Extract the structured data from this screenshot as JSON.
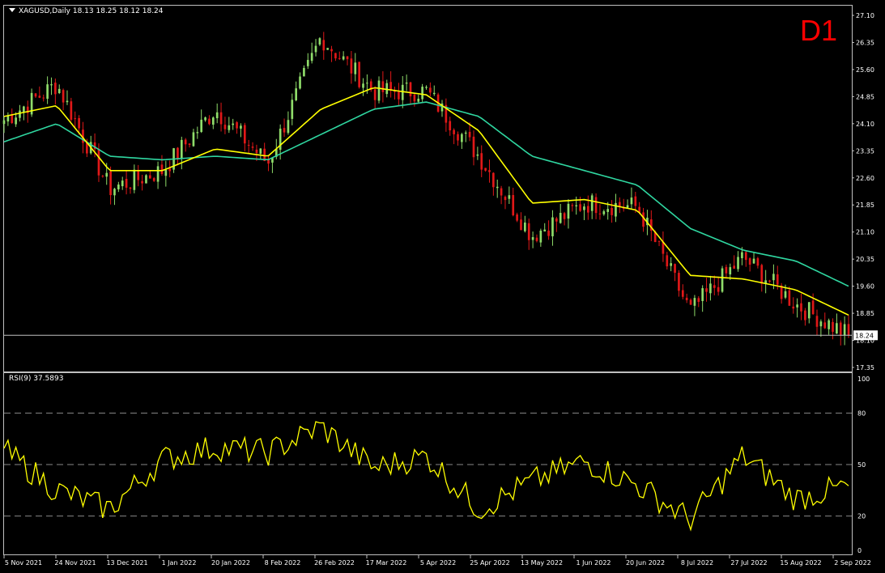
{
  "header": {
    "symbol_line": "XAGUSD,Daily  18.13 18.25 18.12 18.24",
    "timeframe_label": "D1",
    "rsi_label": "RSI(9) 37.5893"
  },
  "price_axis": [
    "27.10",
    "26.35",
    "25.60",
    "24.85",
    "24.10",
    "23.35",
    "22.60",
    "21.85",
    "21.10",
    "20.35",
    "19.60",
    "18.85",
    "18.10",
    "17.35"
  ],
  "current_price": "18.24",
  "rsi_axis": [
    "100",
    "80",
    "50",
    "20",
    "0"
  ],
  "date_axis": [
    "5 Nov 2021",
    "24 Nov 2021",
    "13 Dec 2021",
    "1 Jan 2022",
    "20 Jan 2022",
    "8 Feb 2022",
    "26 Feb 2022",
    "17 Mar 2022",
    "5 Apr 2022",
    "25 Apr 2022",
    "13 May 2022",
    "1 Jun 2022",
    "20 Jun 2022",
    "8 Jul 2022",
    "27 Jul 2022",
    "15 Aug 2022",
    "2 Sep 2022"
  ],
  "colors": {
    "bull": "#8fdc6a",
    "bear": "#e01818",
    "ma_fast": "#ffff00",
    "ma_slow": "#2fd6a0",
    "rsi": "#ffff00",
    "frame": "#c0c0c0"
  },
  "chart_data": [
    {
      "type": "candlestick",
      "symbol": "XAGUSD",
      "timeframe": "Daily",
      "ylim": [
        17.35,
        27.1
      ],
      "last_ohlc": [
        18.13,
        18.25,
        18.12,
        18.24
      ],
      "x": [
        "5 Nov 2021",
        "24 Nov 2021",
        "13 Dec 2021",
        "1 Jan 2022",
        "20 Jan 2022",
        "8 Feb 2022",
        "26 Feb 2022",
        "17 Mar 2022",
        "5 Apr 2022",
        "25 Apr 2022",
        "13 May 2022",
        "1 Jun 2022",
        "20 Jun 2022",
        "8 Jul 2022",
        "27 Jul 2022",
        "15 Aug 2022",
        "2 Sep 2022"
      ],
      "close": [
        24.2,
        25.2,
        22.3,
        22.8,
        24.5,
        23.0,
        26.5,
        25.0,
        25.0,
        23.2,
        21.0,
        21.9,
        21.8,
        18.9,
        20.4,
        19.1,
        18.24
      ],
      "ma_fast": [
        24.3,
        24.6,
        22.8,
        22.8,
        23.4,
        23.2,
        24.5,
        25.1,
        24.9,
        23.9,
        21.9,
        22.0,
        21.7,
        19.9,
        19.8,
        19.5,
        18.8
      ],
      "ma_slow": [
        23.6,
        24.1,
        23.2,
        23.1,
        23.2,
        23.1,
        23.8,
        24.5,
        24.7,
        24.3,
        23.2,
        22.8,
        22.4,
        21.2,
        20.6,
        20.3,
        19.6
      ]
    },
    {
      "type": "line",
      "name": "RSI(9)",
      "ylim": [
        0,
        100
      ],
      "levels": [
        20,
        50,
        80
      ],
      "x": [
        "5 Nov 2021",
        "24 Nov 2021",
        "13 Dec 2021",
        "1 Jan 2022",
        "20 Jan 2022",
        "8 Feb 2022",
        "26 Feb 2022",
        "17 Mar 2022",
        "5 Apr 2022",
        "25 Apr 2022",
        "13 May 2022",
        "1 Jun 2022",
        "20 Jun 2022",
        "8 Jul 2022",
        "27 Jul 2022",
        "15 Aug 2022",
        "2 Sep 2022"
      ],
      "values": [
        58,
        35,
        24,
        53,
        60,
        57,
        72,
        48,
        55,
        24,
        40,
        52,
        38,
        18,
        55,
        30,
        37.59
      ]
    }
  ]
}
